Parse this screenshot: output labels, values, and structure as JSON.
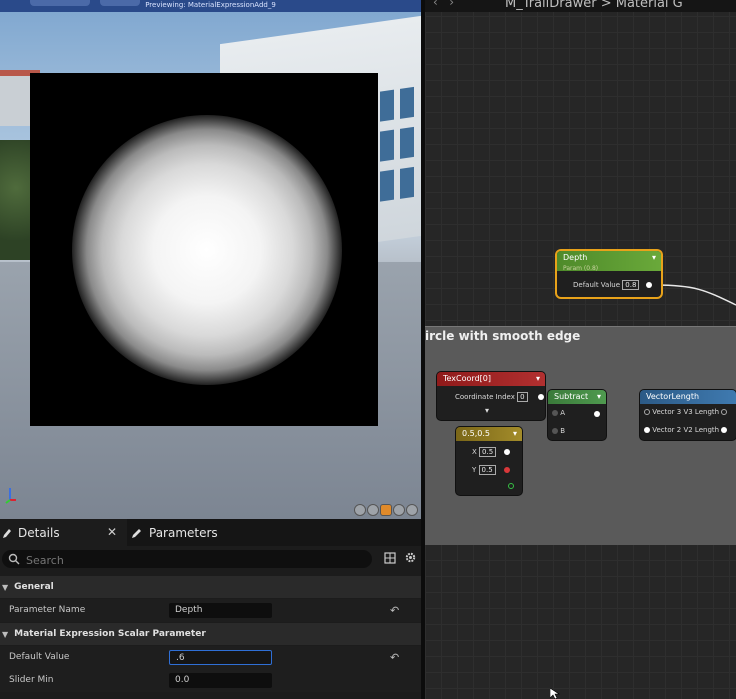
{
  "viewport": {
    "preview_label": "Previewing: MaterialExpressionAdd_9"
  },
  "details_panel": {
    "tabs": [
      {
        "label": "Details"
      },
      {
        "label": "Parameters"
      }
    ],
    "search_placeholder": "Search",
    "categories": [
      {
        "label": "General"
      },
      {
        "label": "Material Expression Scalar Parameter"
      }
    ],
    "properties": {
      "parameter_name": {
        "label": "Parameter Name",
        "value": "Depth"
      },
      "default_value": {
        "label": "Default Value",
        "value": ".6"
      },
      "slider_min": {
        "label": "Slider Min",
        "value": "0.0"
      }
    }
  },
  "graph": {
    "breadcrumb": "M_TrailDrawer > Material G",
    "comment_title": "ircle with smooth edge",
    "nodes": {
      "depth": {
        "title": "Depth",
        "subtitle": "Param (0.8)",
        "pin_label": "Default Value",
        "pin_value": "0.8",
        "color": "#4e8a2a"
      },
      "texcoord": {
        "title": "TexCoord[0]",
        "pin_label": "Coordinate Index",
        "pin_value": "0",
        "color": "#9b1f1f"
      },
      "constant2": {
        "title": "0.5,0.5",
        "x_label": "X",
        "x_value": "0.5",
        "y_label": "Y",
        "y_value": "0.5",
        "color": "#8f7a1a"
      },
      "subtract": {
        "title": "Subtract",
        "a_label": "A",
        "b_label": "B",
        "color": "#3f7a3f"
      },
      "vectorlength": {
        "title": "VectorLength",
        "in1_label": "Vector 3",
        "out1_label": "V3 Length",
        "in2_label": "Vector 2",
        "out2_label": "V2 Length",
        "color": "#2f5f8f"
      }
    }
  }
}
